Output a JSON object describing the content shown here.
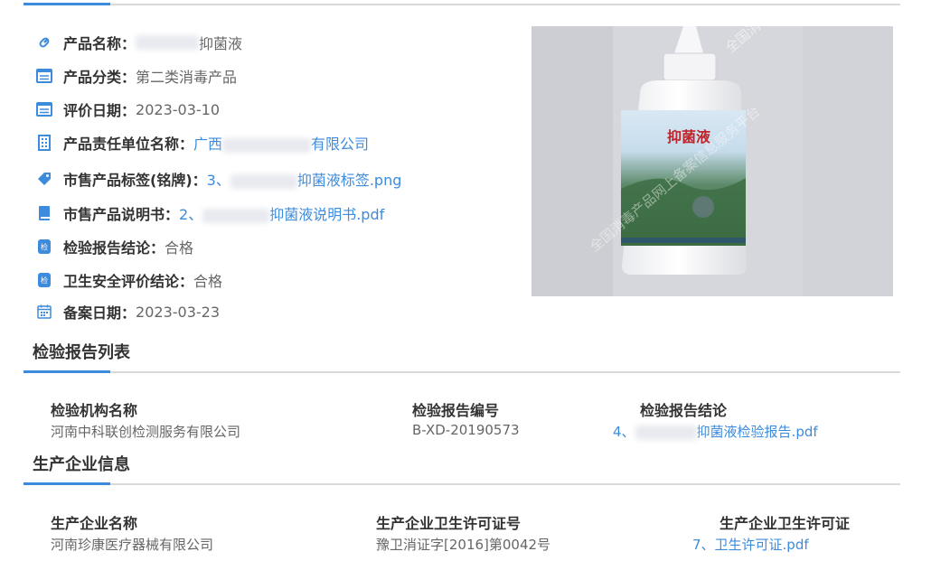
{
  "product": {
    "name_label": "产品名称",
    "name_value": "抑菌液",
    "category_label": "产品分类",
    "category_value": "第二类消毒产品",
    "eval_date_label": "评价日期",
    "eval_date_value": "2023-03-10",
    "responsible_label": "产品责任单位名称",
    "responsible_prefix": "广西",
    "responsible_suffix": "有限公司",
    "tag_label": "市售产品标签(铭牌)",
    "tag_prefix": "3、",
    "tag_suffix": "抑菌液标签.png",
    "manual_label": "市售产品说明书",
    "manual_prefix": "2、",
    "manual_suffix": "抑菌液说明书.pdf",
    "inspection_label": "检验报告结论",
    "inspection_value": "合格",
    "safety_label": "卫生安全评价结论",
    "safety_value": "合格",
    "filing_date_label": "备案日期",
    "filing_date_value": "2023-03-23",
    "colon": "："
  },
  "image": {
    "bottle_label": "抑菌液",
    "watermark_1": "全国消毒产品网上备案信息服务平台",
    "watermark_2": "全国消毒产品网上备案信息服务平台"
  },
  "inspection_section": {
    "title": "检验报告列表",
    "columns": [
      "检验机构名称",
      "检验报告编号",
      "检验报告结论"
    ],
    "row": {
      "agency": "河南中科联创检测服务有限公司",
      "report_no": "B-XD-20190573",
      "report_prefix": "4、",
      "report_suffix": "抑菌液检验报告.pdf"
    }
  },
  "manufacturer_section": {
    "title": "生产企业信息",
    "columns": [
      "生产企业名称",
      "生产企业卫生许可证号",
      "生产企业卫生许可证"
    ],
    "row": {
      "name": "河南珍康医疗器械有限公司",
      "license_no": "豫卫消证字[2016]第0042号",
      "license_file": "7、卫生许可证.pdf"
    }
  },
  "colors": {
    "accent": "#3d8bdc",
    "icon": "#3d8bdc",
    "rule": "#d9d9d9"
  }
}
